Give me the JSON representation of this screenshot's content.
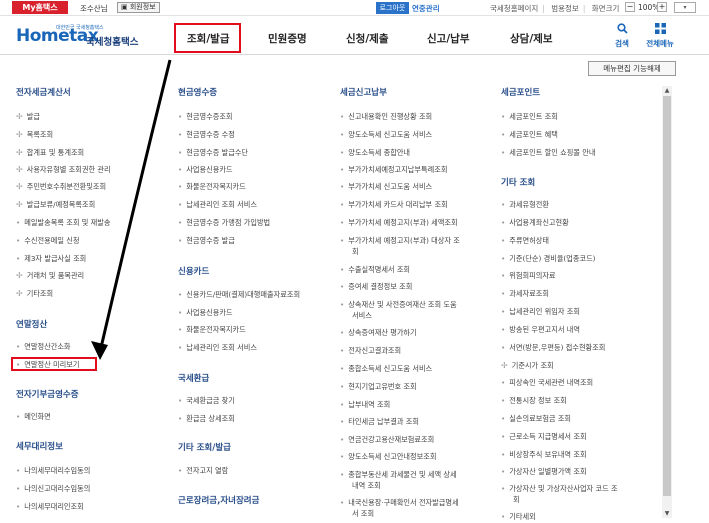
{
  "topbar": {
    "my_tab": "My홈택스",
    "user_name": "조수산님",
    "member_info": "회원정보",
    "logout": "로그아웃",
    "ext": "연중관리",
    "links": [
      "국세청홈페이지",
      "범용정보",
      "화면크기"
    ],
    "zoom_minus": "−",
    "zoom_value": "100%",
    "zoom_plus": "+",
    "lang": "▾"
  },
  "header": {
    "logo_small": "대한민국 국세청홈택스",
    "logo_text": "Hometax",
    "logo_kr": "국세청홈택스",
    "nav": [
      "조회/발급",
      "민원증명",
      "신청/제출",
      "신고/납부",
      "상담/제보"
    ],
    "search_label": "검색",
    "all_menu_label": "전체메뉴"
  },
  "menu_edit": "메뉴편집 기능해제",
  "col1": {
    "sec1": "전자세금계산서",
    "sec1_items": [
      "발급",
      "목록조회",
      "합계표 및 통계조회",
      "사용자유형별 조회권한 관리",
      "주민번호수취분전환및조회",
      "발급보류/예정목록조회",
      "메일발송목록 조회 및 재발송",
      "수신전용메일 신청",
      "제3자 발급사실 조회",
      "거래처 및 품목관리",
      "기타조회"
    ],
    "sec2": "연말정산",
    "sec2_items": [
      "연말정산간소화",
      "연말정산 미리보기"
    ],
    "sec3": "전자기부금영수증",
    "sec3_items": [
      "메인화면"
    ],
    "sec4": "세무대리정보",
    "sec4_items": [
      "나의세무대리수임동의",
      "나의신고대리수임동의",
      "나의세무대리인조회"
    ]
  },
  "col2": {
    "sec1": "현금영수증",
    "sec1_items": [
      "현금영수증조회",
      "현금영수증 수정",
      "현금영수증 발급수단",
      "사업용신용카드",
      "화물운전자복지카드",
      "납세관리인 조회 서비스",
      "현금영수증 가맹점 가입방법",
      "현금영수증 발급"
    ],
    "sec2": "신용카드",
    "sec2_items": [
      "신용카드/판매(결제)대행매출자료조회",
      "사업용신용카드",
      "화물운전자복지카드",
      "납세관리인 조회 서비스"
    ],
    "sec3": "국세환급",
    "sec3_items": [
      "국세환급금 찾기",
      "환급금 상세조회"
    ],
    "sec4": "기타 조회/발급",
    "sec4_items": [
      "전자고지 열람"
    ],
    "sec5": "근로장려금,자녀장려금"
  },
  "col3": {
    "sec1": "세금신고납부",
    "items": [
      "신고내용확인 진행상황 조회",
      "양도소득세 신고도움 서비스",
      "양도소득세 종합안내",
      "부가가치세예정고지납부특례조회",
      "부가가치세 신고도움 서비스",
      "부가가치세 카드사 대리납부 조회",
      "부가가치세 예정고지(부과) 세액조회",
      "부가가치세 예정고지(부과) 대상자 조",
      "회",
      "수출실적명세서 조회",
      "증여세 결정정보 조회",
      "상속재산 및 사전증여재산 조회 도움",
      "서비스",
      "상속증여재산 평가하기",
      "전자신고결과조회",
      "종합소득세 신고도움 서비스",
      "현지기업고유번호 조회",
      "납부내역 조회",
      "타인세금 납부결과 조회",
      "연금건강고용산재보험료조회",
      "양도소득세 신고안내정보조회",
      "종합부동산세 과세물건 및 세액 상세",
      "내역 조회",
      "내국신용장·구매확인서 전자발급명세",
      "서 조회"
    ]
  },
  "col4": {
    "sec1": "세금포인트",
    "sec1_items": [
      "세금포인트 조회",
      "세금포인트 혜택",
      "세금포인트 할인 쇼핑몰 안내"
    ],
    "sec2": "기타 조회",
    "sec2_items": [
      "과세유형전환",
      "사업용계좌신고현황",
      "주류면허상태",
      "기준(단순) 경비율(업종코드)",
      "위험회피의자료",
      "과세자료조회",
      "납세관리인 위임자 조회",
      "방송된 우편고지서 내역",
      "서면(방문,우편등) 접수현황조회",
      "기준시가 조회",
      "피상속인 국세관련 내역조회",
      "전통시장 정보 조회",
      "실손의료보험금 조회",
      "근로소득 지급명세서 조회",
      "비상장주식 보유내역 조회",
      "가상자산 일별평가액 조회",
      "가상자산 및 가상자산사업자 코드 조",
      "회",
      "기타세외"
    ]
  },
  "scroll": {
    "up": "▲",
    "down": "▼"
  }
}
